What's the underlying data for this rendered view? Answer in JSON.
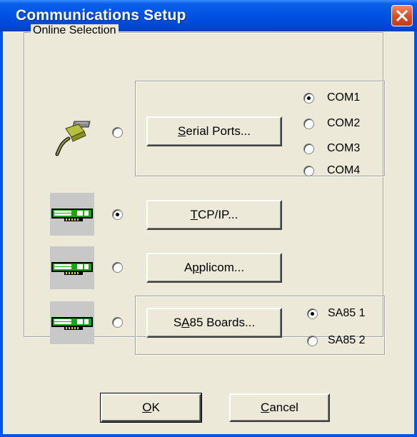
{
  "window": {
    "title": "Communications Setup",
    "close_icon": "close-x-icon",
    "colors": {
      "titlebar": "#0054e3",
      "client": "#ece9d8",
      "close": "#e2542b"
    }
  },
  "group": {
    "label": "Online Selection"
  },
  "serial": {
    "icon": "serial-cable-icon",
    "button": {
      "pre": "",
      "accel": "S",
      "post": "erial Ports..."
    },
    "selected": false,
    "ports": [
      {
        "label": "COM1",
        "selected": true
      },
      {
        "label": "COM2",
        "selected": false
      },
      {
        "label": "COM3",
        "selected": false
      },
      {
        "label": "COM4",
        "selected": false
      }
    ]
  },
  "tcpip": {
    "icon": "network-card-icon",
    "button": {
      "pre": "",
      "accel": "T",
      "post": "CP/IP..."
    },
    "selected": true
  },
  "applicom": {
    "icon": "network-card-icon",
    "button": {
      "pre": "A",
      "accel": "p",
      "post": "plicom..."
    },
    "selected": false
  },
  "sa85": {
    "icon": "network-card-icon",
    "button": {
      "pre": "S",
      "accel": "A",
      "post": "85 Boards..."
    },
    "selected": false,
    "boards": [
      {
        "label": "SA85 1",
        "selected": true
      },
      {
        "label": "SA85 2",
        "selected": false
      }
    ]
  },
  "footer": {
    "ok": {
      "pre": "",
      "accel": "O",
      "post": "K"
    },
    "cancel": {
      "pre": "",
      "accel": "C",
      "post": "ancel"
    }
  }
}
